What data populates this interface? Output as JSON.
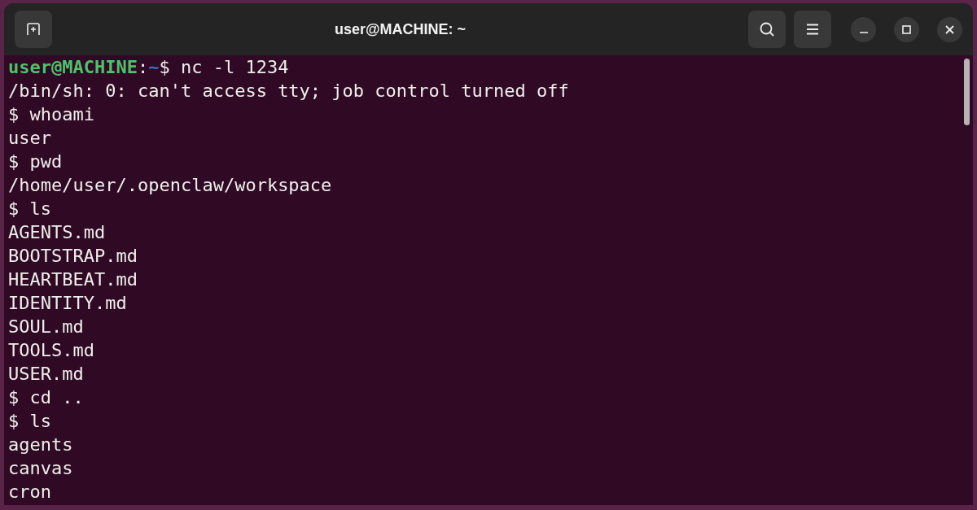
{
  "window": {
    "title": "user@MACHINE: ~"
  },
  "terminal": {
    "lines": [
      {
        "kind": "prompt",
        "user_host": "user@MACHINE",
        "separator": ":",
        "path": "~",
        "command": "$ nc -l 1234"
      },
      {
        "kind": "output",
        "text": "/bin/sh: 0: can't access tty; job control turned off"
      },
      {
        "kind": "output",
        "text": "$ whoami"
      },
      {
        "kind": "output",
        "text": "user"
      },
      {
        "kind": "output",
        "text": "$ pwd"
      },
      {
        "kind": "output",
        "text": "/home/user/.openclaw/workspace"
      },
      {
        "kind": "output",
        "text": "$ ls"
      },
      {
        "kind": "output",
        "text": "AGENTS.md"
      },
      {
        "kind": "output",
        "text": "BOOTSTRAP.md"
      },
      {
        "kind": "output",
        "text": "HEARTBEAT.md"
      },
      {
        "kind": "output",
        "text": "IDENTITY.md"
      },
      {
        "kind": "output",
        "text": "SOUL.md"
      },
      {
        "kind": "output",
        "text": "TOOLS.md"
      },
      {
        "kind": "output",
        "text": "USER.md"
      },
      {
        "kind": "output",
        "text": "$ cd .."
      },
      {
        "kind": "output",
        "text": "$ ls"
      },
      {
        "kind": "output",
        "text": "agents"
      },
      {
        "kind": "output",
        "text": "canvas"
      },
      {
        "kind": "output",
        "text": "cron"
      }
    ]
  }
}
